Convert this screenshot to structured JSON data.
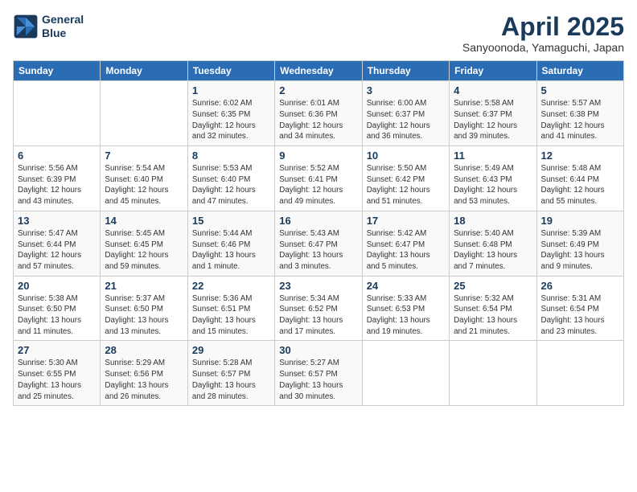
{
  "header": {
    "logo_line1": "General",
    "logo_line2": "Blue",
    "month": "April 2025",
    "location": "Sanyoonoda, Yamaguchi, Japan"
  },
  "weekdays": [
    "Sunday",
    "Monday",
    "Tuesday",
    "Wednesday",
    "Thursday",
    "Friday",
    "Saturday"
  ],
  "weeks": [
    [
      {
        "day": "",
        "info": ""
      },
      {
        "day": "",
        "info": ""
      },
      {
        "day": "1",
        "info": "Sunrise: 6:02 AM\nSunset: 6:35 PM\nDaylight: 12 hours\nand 32 minutes."
      },
      {
        "day": "2",
        "info": "Sunrise: 6:01 AM\nSunset: 6:36 PM\nDaylight: 12 hours\nand 34 minutes."
      },
      {
        "day": "3",
        "info": "Sunrise: 6:00 AM\nSunset: 6:37 PM\nDaylight: 12 hours\nand 36 minutes."
      },
      {
        "day": "4",
        "info": "Sunrise: 5:58 AM\nSunset: 6:37 PM\nDaylight: 12 hours\nand 39 minutes."
      },
      {
        "day": "5",
        "info": "Sunrise: 5:57 AM\nSunset: 6:38 PM\nDaylight: 12 hours\nand 41 minutes."
      }
    ],
    [
      {
        "day": "6",
        "info": "Sunrise: 5:56 AM\nSunset: 6:39 PM\nDaylight: 12 hours\nand 43 minutes."
      },
      {
        "day": "7",
        "info": "Sunrise: 5:54 AM\nSunset: 6:40 PM\nDaylight: 12 hours\nand 45 minutes."
      },
      {
        "day": "8",
        "info": "Sunrise: 5:53 AM\nSunset: 6:40 PM\nDaylight: 12 hours\nand 47 minutes."
      },
      {
        "day": "9",
        "info": "Sunrise: 5:52 AM\nSunset: 6:41 PM\nDaylight: 12 hours\nand 49 minutes."
      },
      {
        "day": "10",
        "info": "Sunrise: 5:50 AM\nSunset: 6:42 PM\nDaylight: 12 hours\nand 51 minutes."
      },
      {
        "day": "11",
        "info": "Sunrise: 5:49 AM\nSunset: 6:43 PM\nDaylight: 12 hours\nand 53 minutes."
      },
      {
        "day": "12",
        "info": "Sunrise: 5:48 AM\nSunset: 6:44 PM\nDaylight: 12 hours\nand 55 minutes."
      }
    ],
    [
      {
        "day": "13",
        "info": "Sunrise: 5:47 AM\nSunset: 6:44 PM\nDaylight: 12 hours\nand 57 minutes."
      },
      {
        "day": "14",
        "info": "Sunrise: 5:45 AM\nSunset: 6:45 PM\nDaylight: 12 hours\nand 59 minutes."
      },
      {
        "day": "15",
        "info": "Sunrise: 5:44 AM\nSunset: 6:46 PM\nDaylight: 13 hours\nand 1 minute."
      },
      {
        "day": "16",
        "info": "Sunrise: 5:43 AM\nSunset: 6:47 PM\nDaylight: 13 hours\nand 3 minutes."
      },
      {
        "day": "17",
        "info": "Sunrise: 5:42 AM\nSunset: 6:47 PM\nDaylight: 13 hours\nand 5 minutes."
      },
      {
        "day": "18",
        "info": "Sunrise: 5:40 AM\nSunset: 6:48 PM\nDaylight: 13 hours\nand 7 minutes."
      },
      {
        "day": "19",
        "info": "Sunrise: 5:39 AM\nSunset: 6:49 PM\nDaylight: 13 hours\nand 9 minutes."
      }
    ],
    [
      {
        "day": "20",
        "info": "Sunrise: 5:38 AM\nSunset: 6:50 PM\nDaylight: 13 hours\nand 11 minutes."
      },
      {
        "day": "21",
        "info": "Sunrise: 5:37 AM\nSunset: 6:50 PM\nDaylight: 13 hours\nand 13 minutes."
      },
      {
        "day": "22",
        "info": "Sunrise: 5:36 AM\nSunset: 6:51 PM\nDaylight: 13 hours\nand 15 minutes."
      },
      {
        "day": "23",
        "info": "Sunrise: 5:34 AM\nSunset: 6:52 PM\nDaylight: 13 hours\nand 17 minutes."
      },
      {
        "day": "24",
        "info": "Sunrise: 5:33 AM\nSunset: 6:53 PM\nDaylight: 13 hours\nand 19 minutes."
      },
      {
        "day": "25",
        "info": "Sunrise: 5:32 AM\nSunset: 6:54 PM\nDaylight: 13 hours\nand 21 minutes."
      },
      {
        "day": "26",
        "info": "Sunrise: 5:31 AM\nSunset: 6:54 PM\nDaylight: 13 hours\nand 23 minutes."
      }
    ],
    [
      {
        "day": "27",
        "info": "Sunrise: 5:30 AM\nSunset: 6:55 PM\nDaylight: 13 hours\nand 25 minutes."
      },
      {
        "day": "28",
        "info": "Sunrise: 5:29 AM\nSunset: 6:56 PM\nDaylight: 13 hours\nand 26 minutes."
      },
      {
        "day": "29",
        "info": "Sunrise: 5:28 AM\nSunset: 6:57 PM\nDaylight: 13 hours\nand 28 minutes."
      },
      {
        "day": "30",
        "info": "Sunrise: 5:27 AM\nSunset: 6:57 PM\nDaylight: 13 hours\nand 30 minutes."
      },
      {
        "day": "",
        "info": ""
      },
      {
        "day": "",
        "info": ""
      },
      {
        "day": "",
        "info": ""
      }
    ]
  ]
}
